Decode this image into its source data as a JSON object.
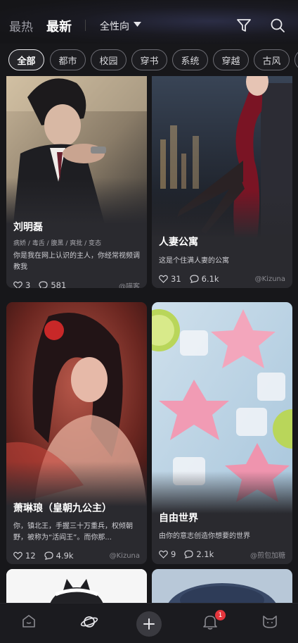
{
  "header": {
    "tab_hot": "最热",
    "tab_new": "最新",
    "gender_filter": "全性向"
  },
  "categories": [
    "全部",
    "都市",
    "校园",
    "穿书",
    "系统",
    "穿越",
    "古风"
  ],
  "cards": [
    {
      "title": "刘明磊",
      "tags": "病娇 / 毒舌 / 腹黑 / 爽批 / 变态",
      "desc": "你是我在网上认识的主人，你经常视频调教我",
      "likes": "3",
      "comments": "581",
      "author": "@喵客"
    },
    {
      "title": "人妻公寓",
      "tags": "",
      "desc": "这是个住满人妻的公寓",
      "likes": "31",
      "comments": "6.1k",
      "author": "@Kizuna"
    },
    {
      "title": "萧琳琅（皇朝九公主）",
      "tags": "",
      "desc": "你，镇北王，手握三十万重兵，权倾朝野，被称为“活阎王”。而你那...",
      "likes": "12",
      "comments": "4.9k",
      "author": "@Kizuna"
    },
    {
      "title": "自由世界",
      "tags": "",
      "desc": "由你的意志创造你想要的世界",
      "likes": "9",
      "comments": "2.1k",
      "author": "@煎包加糖"
    }
  ],
  "notifications": {
    "badge": "1"
  },
  "colors": {
    "background": "#17171a",
    "card": "#2a2a2f",
    "badge": "#e5363d"
  },
  "icons": [
    "filter-icon",
    "search-icon",
    "heart-icon",
    "comment-icon",
    "home-icon",
    "planet-icon",
    "plus-icon",
    "bell-icon",
    "cat-icon"
  ]
}
